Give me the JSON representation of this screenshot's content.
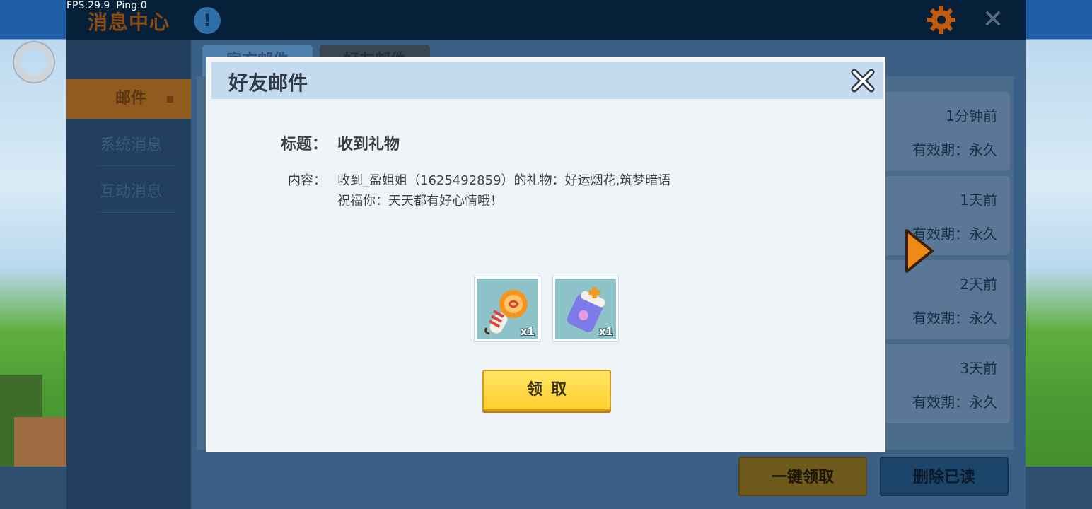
{
  "overlay": {
    "fps": "FPS:29.9",
    "ping": "Ping:0"
  },
  "panel": {
    "title": "消息中心",
    "info_label": "!",
    "sidebar": [
      {
        "label": "邮件",
        "active": true
      },
      {
        "label": "系统消息",
        "active": false
      },
      {
        "label": "互动消息",
        "active": false
      }
    ],
    "tabs": [
      "官方邮件",
      "好友邮件"
    ],
    "mails": [
      {
        "time": "1分钟前",
        "expiry": "有效期：永久"
      },
      {
        "time": "1天前",
        "expiry": "有效期：永久"
      },
      {
        "time": "2天前",
        "expiry": "有效期：永久"
      },
      {
        "time": "3天前",
        "expiry": "有效期：永久"
      }
    ],
    "claim_all_label": "一键领取",
    "delete_read_label": "删除已读"
  },
  "dialog": {
    "header": "好友邮件",
    "title_label": "标题：",
    "title_value": "收到礼物",
    "content_label": "内容：",
    "content_line1": "收到_盈姐姐（1625492859）的礼物：好运烟花,筑梦暗语",
    "content_line2": "祝福你：天天都有好心情哦！",
    "items": [
      {
        "icon": "firework-candy-icon",
        "qty": "x1"
      },
      {
        "icon": "dream-jar-icon",
        "qty": "x1"
      }
    ],
    "claim_label": "领取"
  },
  "colors": {
    "dialog_bg": "#eef4f8",
    "dialog_header": "#c5d9ef",
    "claim_button": "#ffd940",
    "accent_orange": "#f08a16"
  }
}
